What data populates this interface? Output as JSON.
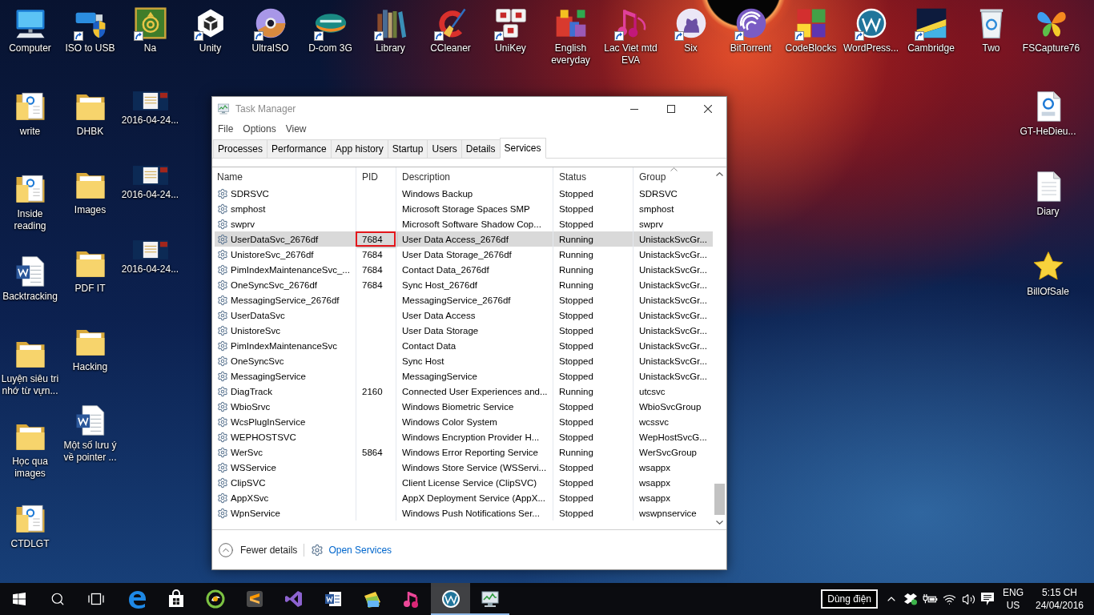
{
  "desktop": {
    "top_row": [
      {
        "label": "Computer",
        "shortcut": false
      },
      {
        "label": "ISO to USB",
        "shortcut": true
      },
      {
        "label": "Na",
        "shortcut": true
      },
      {
        "label": "Unity",
        "shortcut": true
      },
      {
        "label": "UltraISO",
        "shortcut": true
      },
      {
        "label": "D-com 3G",
        "shortcut": true
      },
      {
        "label": "Library",
        "shortcut": true
      },
      {
        "label": "CCleaner",
        "shortcut": true
      },
      {
        "label": "UniKey",
        "shortcut": true
      },
      {
        "label": "English everyday",
        "shortcut": false
      },
      {
        "label": "Lac Viet mtd EVA",
        "shortcut": true
      },
      {
        "label": "Six",
        "shortcut": true
      },
      {
        "label": "BitTorrent",
        "shortcut": true
      },
      {
        "label": "CodeBlocks",
        "shortcut": true
      },
      {
        "label": "WordPress...",
        "shortcut": true
      },
      {
        "label": "Cambridge",
        "shortcut": true
      },
      {
        "label": "Two",
        "shortcut": false
      },
      {
        "label": "FSCapture76",
        "shortcut": false
      }
    ],
    "left_columns": [
      [
        {
          "label": "write"
        },
        {
          "label": "Inside reading"
        },
        {
          "label": "Backtracking"
        },
        {
          "label": "Luyện siêu tri nhớ từ vựn..."
        },
        {
          "label": "Học qua images"
        },
        {
          "label": "CTDLGT"
        }
      ],
      [
        {
          "label": "DHBK"
        },
        {
          "label": "Images"
        },
        {
          "label": "PDF IT"
        },
        {
          "label": "Hacking"
        },
        {
          "label": "Một số lưu ý về pointer ..."
        }
      ],
      [
        {
          "label": "2016-04-24..."
        },
        {
          "label": "2016-04-24..."
        },
        {
          "label": "2016-04-24..."
        }
      ]
    ],
    "right_column": [
      {
        "label": "GT-HeDieu..."
      },
      {
        "label": "Diary"
      },
      {
        "label": "BillOfSale"
      }
    ]
  },
  "task_manager": {
    "title": "Task Manager",
    "menu": [
      "File",
      "Options",
      "View"
    ],
    "tabs": [
      {
        "label": "Processes",
        "selected": false
      },
      {
        "label": "Performance",
        "selected": false
      },
      {
        "label": "App history",
        "selected": false
      },
      {
        "label": "Startup",
        "selected": false
      },
      {
        "label": "Users",
        "selected": false
      },
      {
        "label": "Details",
        "selected": false
      },
      {
        "label": "Services",
        "selected": true
      }
    ],
    "columns": [
      {
        "label": "Name",
        "sorted": false
      },
      {
        "label": "PID",
        "sorted": false
      },
      {
        "label": "Description",
        "sorted": false
      },
      {
        "label": "Status",
        "sorted": false
      },
      {
        "label": "Group",
        "sorted": true
      }
    ],
    "rows": [
      {
        "name": "SDRSVC",
        "description": "Windows Backup",
        "status": "Stopped",
        "group": "SDRSVC",
        "selected": false,
        "pid_boxed": false
      },
      {
        "name": "smphost",
        "description": "Microsoft Storage Spaces SMP",
        "status": "Stopped",
        "group": "smphost",
        "selected": false,
        "pid_boxed": false
      },
      {
        "name": "swprv",
        "description": "Microsoft Software Shadow Cop...",
        "status": "Stopped",
        "group": "swprv",
        "selected": false,
        "pid_boxed": false
      },
      {
        "name": "UserDataSvc_2676df",
        "pid": "7684",
        "description": "User Data Access_2676df",
        "status": "Running",
        "group": "UnistackSvcGr...",
        "selected": true,
        "pid_boxed": true
      },
      {
        "name": "UnistoreSvc_2676df",
        "pid": "7684",
        "description": "User Data Storage_2676df",
        "status": "Running",
        "group": "UnistackSvcGr...",
        "selected": false,
        "pid_boxed": false
      },
      {
        "name": "PimIndexMaintenanceSvc_...",
        "pid": "7684",
        "description": "Contact Data_2676df",
        "status": "Running",
        "group": "UnistackSvcGr...",
        "selected": false,
        "pid_boxed": false
      },
      {
        "name": "OneSyncSvc_2676df",
        "pid": "7684",
        "description": "Sync Host_2676df",
        "status": "Running",
        "group": "UnistackSvcGr...",
        "selected": false,
        "pid_boxed": false
      },
      {
        "name": "MessagingService_2676df",
        "description": "MessagingService_2676df",
        "status": "Stopped",
        "group": "UnistackSvcGr...",
        "selected": false,
        "pid_boxed": false
      },
      {
        "name": "UserDataSvc",
        "description": "User Data Access",
        "status": "Stopped",
        "group": "UnistackSvcGr...",
        "selected": false,
        "pid_boxed": false
      },
      {
        "name": "UnistoreSvc",
        "description": "User Data Storage",
        "status": "Stopped",
        "group": "UnistackSvcGr...",
        "selected": false,
        "pid_boxed": false
      },
      {
        "name": "PimIndexMaintenanceSvc",
        "description": "Contact Data",
        "status": "Stopped",
        "group": "UnistackSvcGr...",
        "selected": false,
        "pid_boxed": false
      },
      {
        "name": "OneSyncSvc",
        "description": "Sync Host",
        "status": "Stopped",
        "group": "UnistackSvcGr...",
        "selected": false,
        "pid_boxed": false
      },
      {
        "name": "MessagingService",
        "description": "MessagingService",
        "status": "Stopped",
        "group": "UnistackSvcGr...",
        "selected": false,
        "pid_boxed": false
      },
      {
        "name": "DiagTrack",
        "pid": "2160",
        "description": "Connected User Experiences and...",
        "status": "Running",
        "group": "utcsvc",
        "selected": false,
        "pid_boxed": false
      },
      {
        "name": "WbioSrvc",
        "description": "Windows Biometric Service",
        "status": "Stopped",
        "group": "WbioSvcGroup",
        "selected": false,
        "pid_boxed": false
      },
      {
        "name": "WcsPlugInService",
        "description": "Windows Color System",
        "status": "Stopped",
        "group": "wcssvc",
        "selected": false,
        "pid_boxed": false
      },
      {
        "name": "WEPHOSTSVC",
        "description": "Windows Encryption Provider H...",
        "status": "Stopped",
        "group": "WepHostSvcG...",
        "selected": false,
        "pid_boxed": false
      },
      {
        "name": "WerSvc",
        "pid": "5864",
        "description": "Windows Error Reporting Service",
        "status": "Running",
        "group": "WerSvcGroup",
        "selected": false,
        "pid_boxed": false
      },
      {
        "name": "WSService",
        "description": "Windows Store Service (WSServi...",
        "status": "Stopped",
        "group": "wsappx",
        "selected": false,
        "pid_boxed": false
      },
      {
        "name": "ClipSVC",
        "description": "Client License Service (ClipSVC)",
        "status": "Stopped",
        "group": "wsappx",
        "selected": false,
        "pid_boxed": false
      },
      {
        "name": "AppXSvc",
        "description": "AppX Deployment Service (AppX...",
        "status": "Stopped",
        "group": "wsappx",
        "selected": false,
        "pid_boxed": false
      },
      {
        "name": "WpnService",
        "description": "Windows Push Notifications Ser...",
        "status": "Stopped",
        "group": "wswpnservice",
        "selected": false,
        "pid_boxed": false
      }
    ],
    "footer": {
      "fewer_details": "Fewer details",
      "open_services": "Open Services"
    }
  },
  "taskbar": {
    "apps": [
      {
        "selected": false,
        "running": false
      },
      {
        "selected": false,
        "running": false
      },
      {
        "selected": false,
        "running": false
      },
      {
        "selected": false,
        "running": false
      },
      {
        "selected": false,
        "running": false
      },
      {
        "selected": false,
        "running": false
      },
      {
        "selected": false,
        "running": false
      },
      {
        "selected": false,
        "running": false
      },
      {
        "selected": true,
        "running": true
      },
      {
        "selected": false,
        "running": true
      }
    ],
    "tooltip": "Dùng điện",
    "language": "ENG",
    "region": "US",
    "time": "5:15 CH",
    "date": "24/04/2016"
  }
}
